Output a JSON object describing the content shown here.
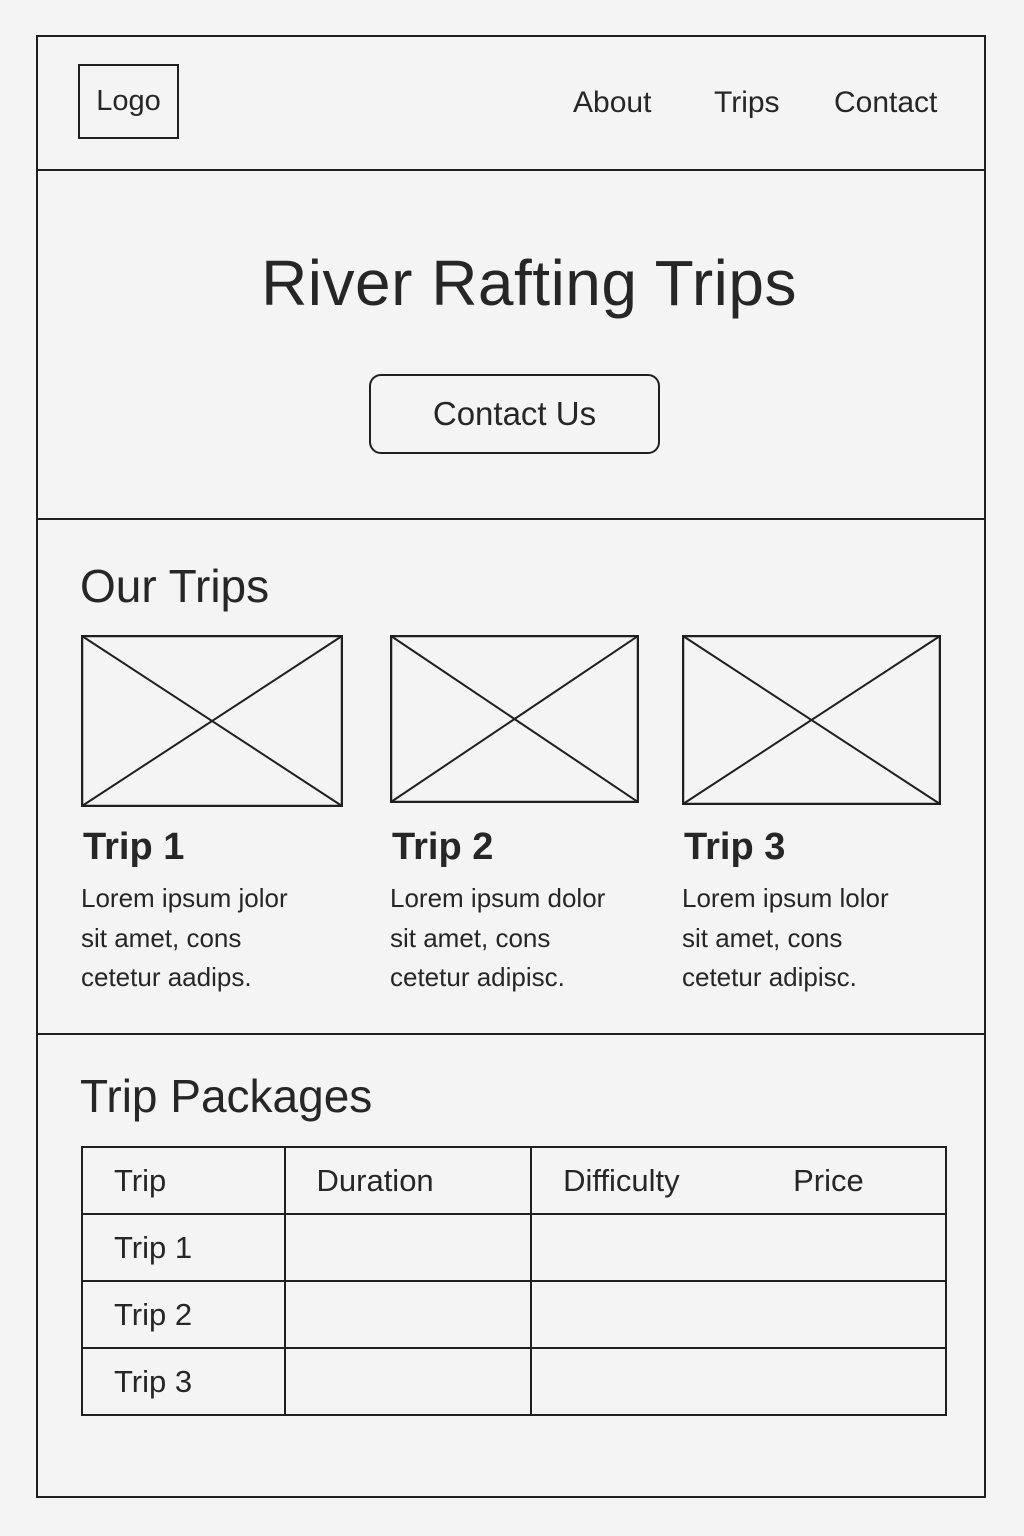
{
  "header": {
    "logo": "Logo",
    "nav": {
      "about": "About",
      "trips": "Trips",
      "contact": "Contact"
    }
  },
  "hero": {
    "title": "River Rafting Trips",
    "cta": "Contact Us"
  },
  "our_trips": {
    "title": "Our Trips",
    "cards": [
      {
        "name": "Trip 1",
        "desc_lines": [
          "Lorem ipsum jolor",
          "sit amet, cons",
          "cetetur aadips."
        ]
      },
      {
        "name": "Trip 2",
        "desc_lines": [
          "Lorem ipsum dolor",
          "sit amet, cons",
          "cetetur adipisc."
        ]
      },
      {
        "name": "Trip 3",
        "desc_lines": [
          "Lorem ipsum lolor",
          "sit amet, cons",
          "cetetur adipisc."
        ]
      }
    ]
  },
  "packages": {
    "title": "Trip Packages",
    "columns": [
      "Trip",
      "Duration",
      "Difficulty",
      "Price"
    ],
    "rows": [
      {
        "trip": "Trip 1"
      },
      {
        "trip": "Trip 2"
      },
      {
        "trip": "Trip 3"
      }
    ]
  }
}
